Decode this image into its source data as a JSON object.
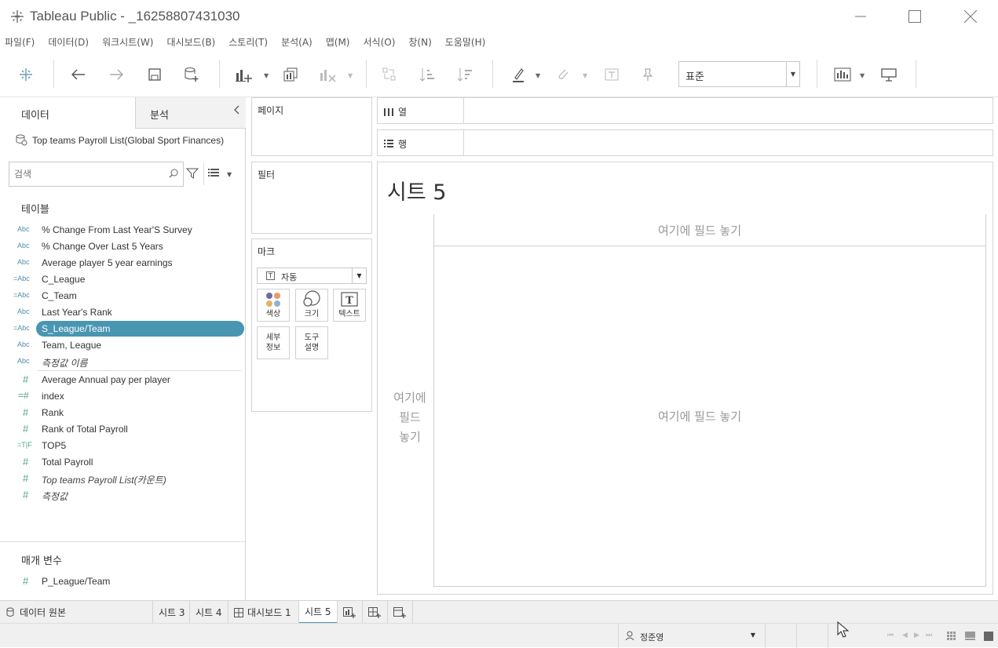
{
  "window": {
    "title": "Tableau Public - _16258807431030"
  },
  "menu": [
    "파일(F)",
    "데이터(D)",
    "워크시트(W)",
    "대시보드(B)",
    "스토리(T)",
    "분석(A)",
    "맵(M)",
    "서식(O)",
    "창(N)",
    "도움말(H)"
  ],
  "toolbar": {
    "fit_value": "표준"
  },
  "left": {
    "tab_data": "데이터",
    "tab_analysis": "분석",
    "datasource": "Top teams Payroll List(Global Sport Finances)",
    "search_placeholder": "검색",
    "tables_title": "테이블",
    "dimensions": [
      {
        "icon": "Abc",
        "label": "% Change From Last Year'S Survey"
      },
      {
        "icon": "Abc",
        "label": "% Change Over Last 5 Years"
      },
      {
        "icon": "Abc",
        "label": "Average player 5 year earnings"
      },
      {
        "icon": "=Abc",
        "label": "C_League"
      },
      {
        "icon": "=Abc",
        "label": "C_Team"
      },
      {
        "icon": "Abc",
        "label": "Last Year's Rank"
      },
      {
        "icon": "=Abc",
        "label": "S_League/Team"
      },
      {
        "icon": "Abc",
        "label": "Team, League"
      },
      {
        "icon": "Abc",
        "label": "측정값 이름"
      }
    ],
    "measures": [
      {
        "icon": "#",
        "label": "Average Annual pay per player"
      },
      {
        "icon": "=#",
        "label": "index"
      },
      {
        "icon": "#",
        "label": "Rank"
      },
      {
        "icon": "#",
        "label": "Rank of Total Payroll"
      },
      {
        "icon": "=T|F",
        "label": "TOP5"
      },
      {
        "icon": "#",
        "label": "Total Payroll"
      },
      {
        "icon": "#",
        "label": "Top teams Payroll List(카운트)"
      },
      {
        "icon": "#",
        "label": "측정값"
      }
    ],
    "params_title": "매개 변수",
    "params": [
      {
        "icon": "#",
        "label": "P_League/Team"
      }
    ]
  },
  "cards": {
    "pages": "페이지",
    "filters": "필터",
    "marks": "마크",
    "marks_type": "자동",
    "color": "색상",
    "size": "크기",
    "text": "텍스트",
    "detail_1": "세부",
    "detail_2": "정보",
    "tooltip_1": "도구",
    "tooltip_2": "설명"
  },
  "shelves": {
    "columns": "열",
    "rows": "행"
  },
  "viz": {
    "sheet_title": "시트 5",
    "drop_top": "여기에 필드 놓기",
    "drop_left_1": "여기에",
    "drop_left_2": "필드",
    "drop_left_3": "놓기",
    "drop_main": "여기에 필드 놓기"
  },
  "tabs": {
    "datasource": "데이터 원본",
    "sheets": [
      "시트 3",
      "시트 4",
      "대시보드 1",
      "시트 5"
    ]
  },
  "status": {
    "user": "정준영"
  },
  "colors": {
    "accent": "#4996b2",
    "measure": "#4fa58c",
    "dimension": "#4f8fa8"
  }
}
